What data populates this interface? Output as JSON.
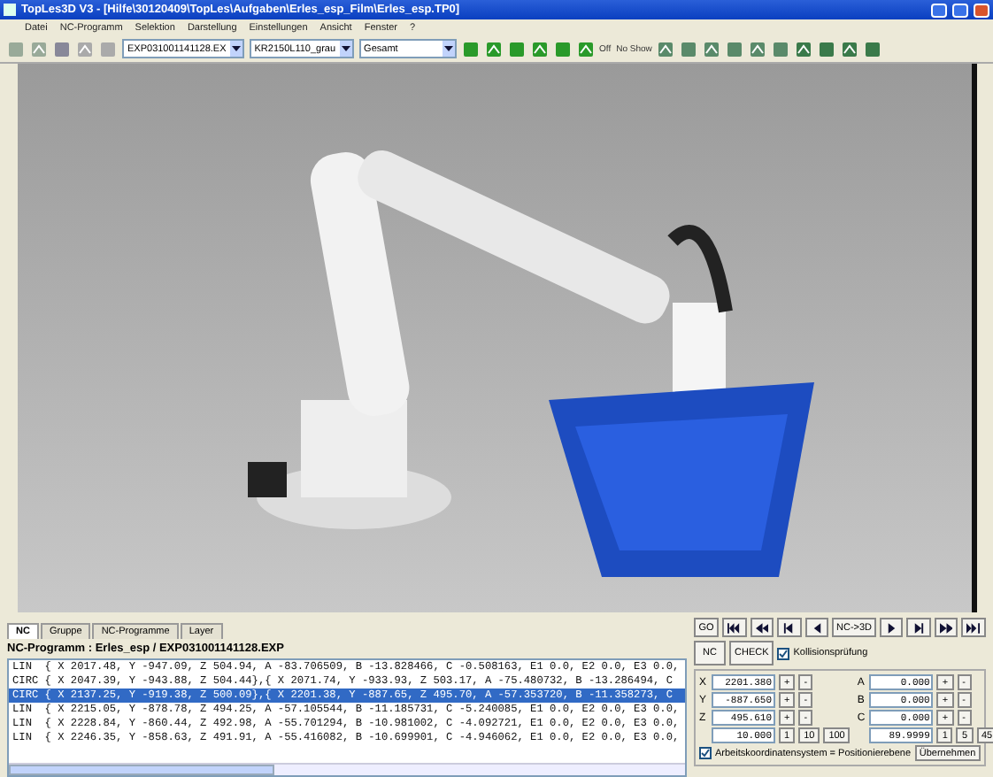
{
  "window": {
    "title": "TopLes3D V3 - [Hilfe\\30120409\\TopLes\\Aufgaben\\Erles_esp_Film\\Erles_esp.TP0]"
  },
  "menu": [
    "Datei",
    "NC-Programm",
    "Selektion",
    "Darstellung",
    "Einstellungen",
    "Ansicht",
    "Fenster",
    "?"
  ],
  "toolbar": {
    "combos": [
      "EXP031001141128.EX",
      "KR2150L110_grau",
      "Gesamt"
    ],
    "texts": [
      "Off",
      "No Show"
    ]
  },
  "nc_panel": {
    "tabs": [
      {
        "label": "NC",
        "selected": true
      },
      {
        "label": "Gruppe",
        "selected": false
      },
      {
        "label": "NC-Programme",
        "selected": false
      },
      {
        "label": "Layer",
        "selected": false
      }
    ],
    "program_title": "NC-Programm : Erles_esp / EXP031001141128.EXP",
    "lines": [
      {
        "text": "LIN  { X 2017.48, Y -947.09, Z 504.94, A -83.706509, B -13.828466, C -0.508163, E1 0.0, E2 0.0, E3 0.0,",
        "selected": false
      },
      {
        "text": "CIRC { X 2047.39, Y -943.88, Z 504.44},{ X 2071.74, Y -933.93, Z 503.17, A -75.480732, B -13.286494, C",
        "selected": false
      },
      {
        "text": "CIRC { X 2137.25, Y -919.38, Z 500.09},{ X 2201.38, Y -887.65, Z 495.70, A -57.353720, B -11.358273, C",
        "selected": true
      },
      {
        "text": "LIN  { X 2215.05, Y -878.78, Z 494.25, A -57.105544, B -11.185731, C -5.240085, E1 0.0, E2 0.0, E3 0.0,",
        "selected": false
      },
      {
        "text": "LIN  { X 2228.84, Y -860.44, Z 492.98, A -55.701294, B -10.981002, C -4.092721, E1 0.0, E2 0.0, E3 0.0,",
        "selected": false
      },
      {
        "text": "LIN  { X 2246.35, Y -858.63, Z 491.91, A -55.416082, B -10.699901, C -4.946062, E1 0.0, E2 0.0, E3 0.0,",
        "selected": false
      }
    ]
  },
  "control_panel": {
    "go": "GO",
    "nc3d": "NC->3D",
    "nc": "NC",
    "check": "CHECK",
    "collision": {
      "label": "Kollisionsprüfung",
      "checked": true
    },
    "coords": [
      {
        "axis": "X",
        "value": "2201.380",
        "plus": "+",
        "minus": "-"
      },
      {
        "axis": "Y",
        "value": "-887.650",
        "plus": "+",
        "minus": "-"
      },
      {
        "axis": "Z",
        "value": "495.610",
        "plus": "+",
        "minus": "-"
      },
      {
        "axis": "A",
        "value": "0.000",
        "plus": "+",
        "minus": "-"
      },
      {
        "axis": "B",
        "value": "0.000",
        "plus": "+",
        "minus": "-"
      },
      {
        "axis": "C",
        "value": "0.000",
        "plus": "+",
        "minus": "-"
      }
    ],
    "step_linear": {
      "value": "10.000",
      "steps": [
        "1",
        "10",
        "100"
      ]
    },
    "step_angle": {
      "value": "89.9999",
      "steps": [
        "1",
        "5",
        "45"
      ]
    },
    "work_coords": {
      "label": "Arbeitskoordinatensystem = Positionierebene",
      "checked": true
    },
    "apply": "Übernehmen"
  }
}
